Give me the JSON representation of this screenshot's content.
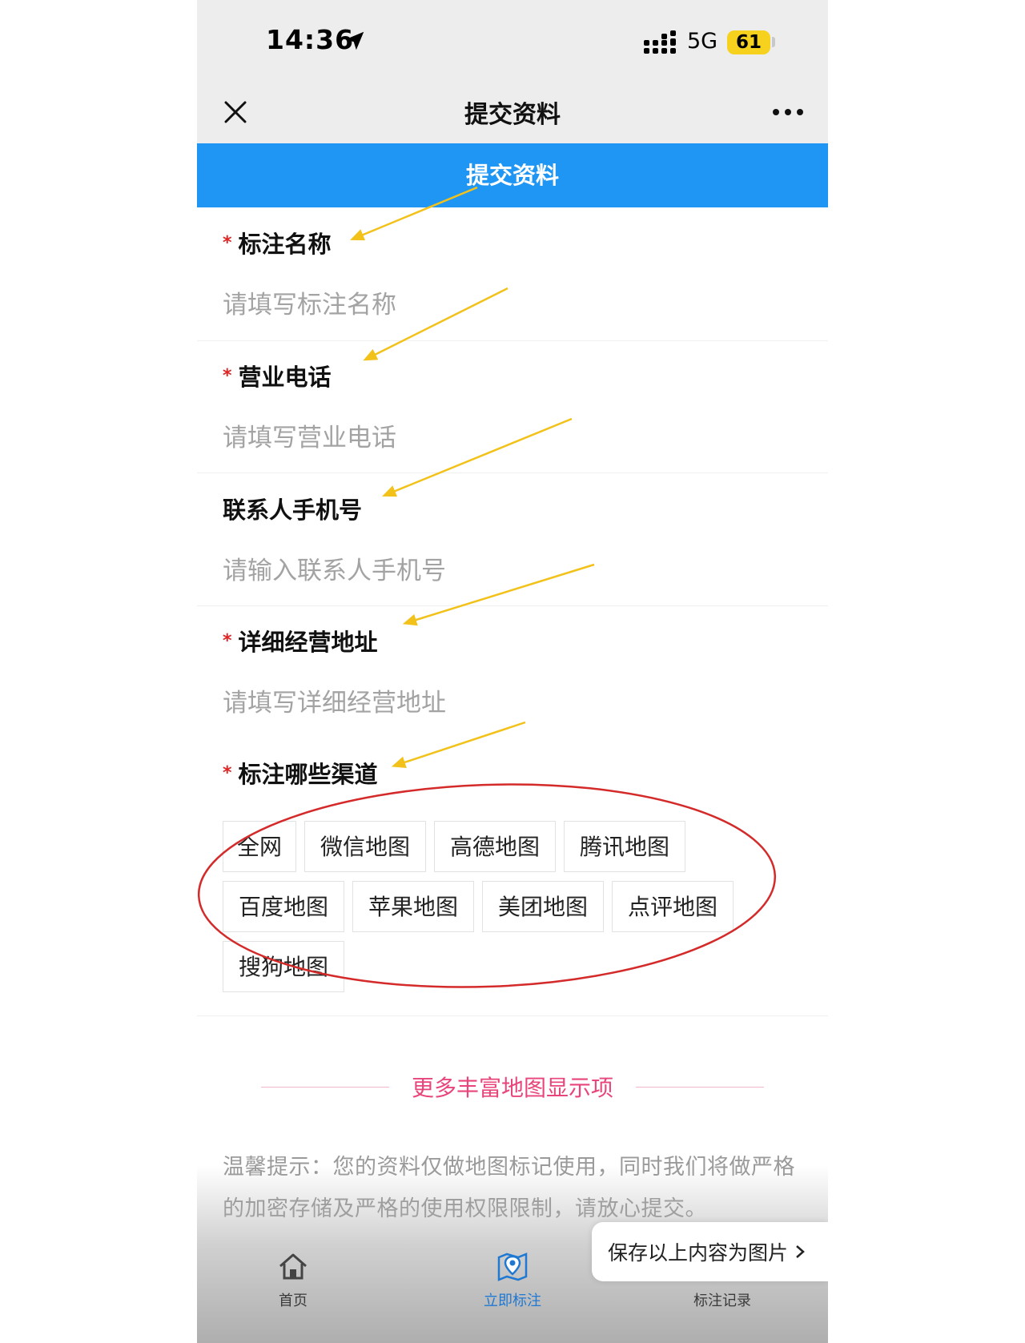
{
  "status_bar": {
    "time": "14:36",
    "network": "5G",
    "battery": "61"
  },
  "nav": {
    "title": "提交资料"
  },
  "header": {
    "title": "提交资料"
  },
  "form": {
    "fields": [
      {
        "label": "标注名称",
        "required": true,
        "placeholder": "请填写标注名称"
      },
      {
        "label": "营业电话",
        "required": true,
        "placeholder": "请填写营业电话"
      },
      {
        "label": "联系人手机号",
        "required": false,
        "placeholder": "请输入联系人手机号"
      },
      {
        "label": "详细经营地址",
        "required": true,
        "placeholder": "请填写详细经营地址"
      }
    ],
    "required_mark": "*",
    "channels": {
      "label": "标注哪些渠道",
      "required": true,
      "options": [
        "全网",
        "微信地图",
        "高德地图",
        "腾讯地图",
        "百度地图",
        "苹果地图",
        "美团地图",
        "点评地图",
        "搜狗地图"
      ]
    }
  },
  "more_link": "更多丰富地图显示项",
  "tip": "温馨提示：您的资料仅做地图标记使用，同时我们将做严格的加密存储及严格的使用权限限制，请放心提交。",
  "tabbar": {
    "items": [
      {
        "label": "首页",
        "icon": "home-icon"
      },
      {
        "label": "立即标注",
        "icon": "map-pin-icon",
        "active": true
      },
      {
        "label": "标注记录",
        "icon": "record-icon"
      }
    ]
  },
  "save_popup": {
    "label": "保存以上内容为图片"
  },
  "colors": {
    "brand_blue": "#1f96f3",
    "required_red": "#e02424",
    "link_pink": "#e8467a",
    "annotation_yellow": "#f2c21a",
    "annotation_red": "#d42a2a"
  }
}
